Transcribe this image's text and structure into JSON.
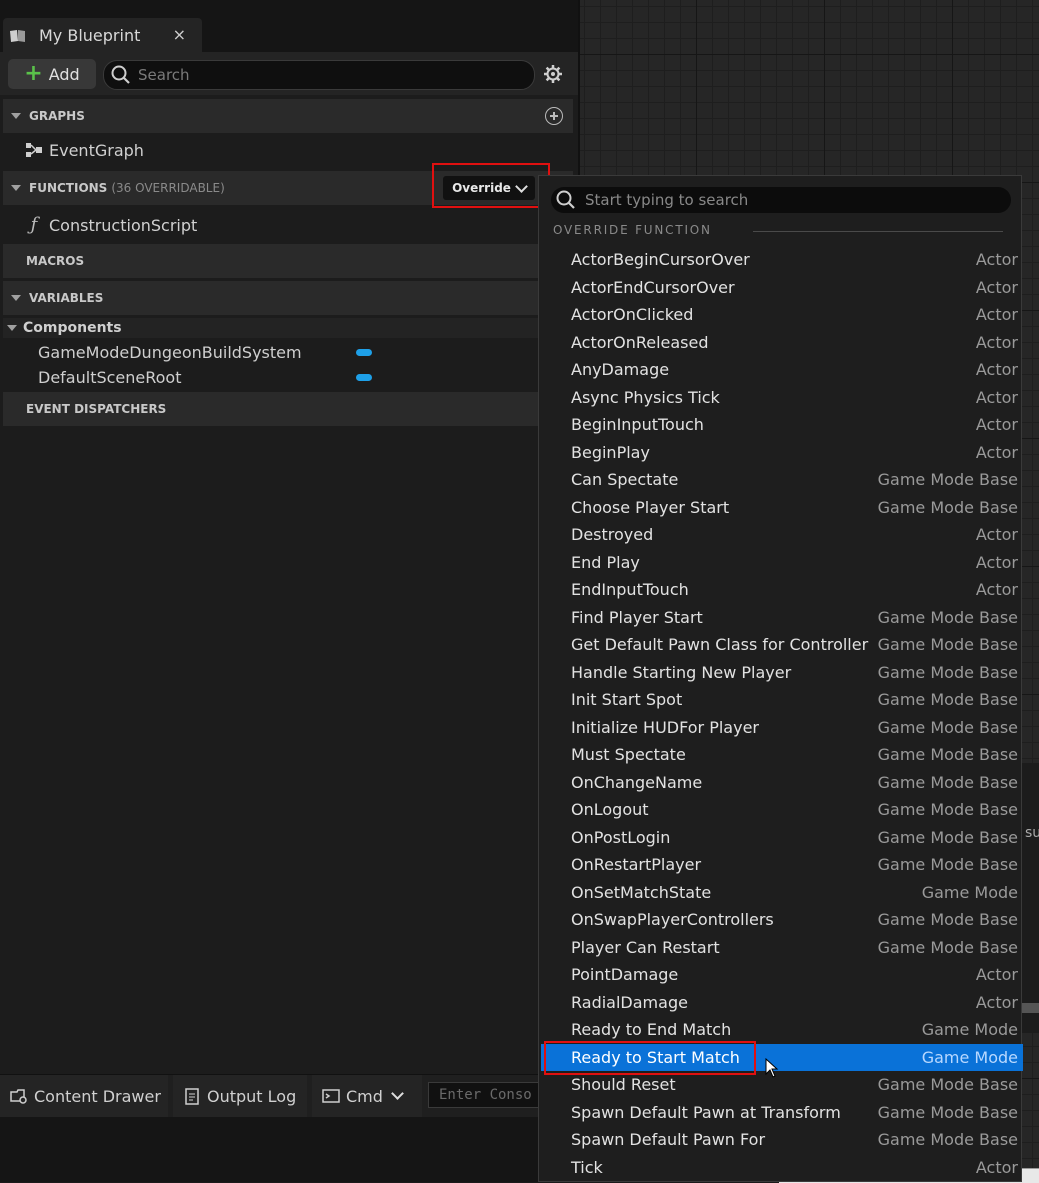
{
  "tab": {
    "title": "My Blueprint",
    "close": "×"
  },
  "toolbar": {
    "add_label": "Add",
    "search_placeholder": "Search"
  },
  "sections": {
    "graphs": "GRAPHS",
    "functions": "FUNCTIONS",
    "functions_count": "(36 OVERRIDABLE)",
    "macros": "MACROS",
    "variables": "VARIABLES",
    "event_dispatchers": "EVENT DISPATCHERS"
  },
  "graphs": {
    "items": [
      "EventGraph"
    ]
  },
  "functions": {
    "items": [
      "ConstructionScript"
    ]
  },
  "override_button": "Override",
  "components": {
    "header": "Components",
    "items": [
      "GameModeDungeonBuildSystem",
      "DefaultSceneRoot"
    ]
  },
  "bottom": {
    "content_drawer": "Content Drawer",
    "output_log": "Output Log",
    "cmd": "Cmd",
    "console_placeholder": "Enter Conso"
  },
  "popup": {
    "search_placeholder": "Start typing to search",
    "category": "OVERRIDE FUNCTION",
    "functions": [
      {
        "name": "ActorBeginCursorOver",
        "source": "Actor"
      },
      {
        "name": "ActorEndCursorOver",
        "source": "Actor"
      },
      {
        "name": "ActorOnClicked",
        "source": "Actor"
      },
      {
        "name": "ActorOnReleased",
        "source": "Actor"
      },
      {
        "name": "AnyDamage",
        "source": "Actor"
      },
      {
        "name": "Async Physics Tick",
        "source": "Actor"
      },
      {
        "name": "BeginInputTouch",
        "source": "Actor"
      },
      {
        "name": "BeginPlay",
        "source": "Actor"
      },
      {
        "name": "Can Spectate",
        "source": "Game Mode Base"
      },
      {
        "name": "Choose Player Start",
        "source": "Game Mode Base"
      },
      {
        "name": "Destroyed",
        "source": "Actor"
      },
      {
        "name": "End Play",
        "source": "Actor"
      },
      {
        "name": "EndInputTouch",
        "source": "Actor"
      },
      {
        "name": "Find Player Start",
        "source": "Game Mode Base"
      },
      {
        "name": "Get Default Pawn Class for Controller",
        "source": "Game Mode Base"
      },
      {
        "name": "Handle Starting New Player",
        "source": "Game Mode Base"
      },
      {
        "name": "Init Start Spot",
        "source": "Game Mode Base"
      },
      {
        "name": "Initialize HUDFor Player",
        "source": "Game Mode Base"
      },
      {
        "name": "Must Spectate",
        "source": "Game Mode Base"
      },
      {
        "name": "OnChangeName",
        "source": "Game Mode Base"
      },
      {
        "name": "OnLogout",
        "source": "Game Mode Base"
      },
      {
        "name": "OnPostLogin",
        "source": "Game Mode Base"
      },
      {
        "name": "OnRestartPlayer",
        "source": "Game Mode Base"
      },
      {
        "name": "OnSetMatchState",
        "source": "Game Mode"
      },
      {
        "name": "OnSwapPlayerControllers",
        "source": "Game Mode Base"
      },
      {
        "name": "Player Can Restart",
        "source": "Game Mode Base"
      },
      {
        "name": "PointDamage",
        "source": "Actor"
      },
      {
        "name": "RadialDamage",
        "source": "Actor"
      },
      {
        "name": "Ready to End Match",
        "source": "Game Mode"
      },
      {
        "name": "Ready to Start Match",
        "source": "Game Mode",
        "selected": true
      },
      {
        "name": "Should Reset",
        "source": "Game Mode Base"
      },
      {
        "name": "Spawn Default Pawn at Transform",
        "source": "Game Mode Base"
      },
      {
        "name": "Spawn Default Pawn For",
        "source": "Game Mode Base"
      },
      {
        "name": "Tick",
        "source": "Actor"
      }
    ]
  },
  "graph_panel": {
    "clipped_text": "su"
  },
  "colors": {
    "accent": "#0a72d8",
    "highlight_outline": "#e01010",
    "component_pill": "#1ea0e8"
  },
  "icons": [
    "book-icon",
    "plus-icon",
    "search-icon",
    "gear-icon",
    "add-graph-icon",
    "event-graph-icon",
    "function-icon",
    "chevron-down-icon",
    "content-drawer-icon",
    "output-log-icon",
    "cmd-icon",
    "mouse-cursor-icon"
  ]
}
